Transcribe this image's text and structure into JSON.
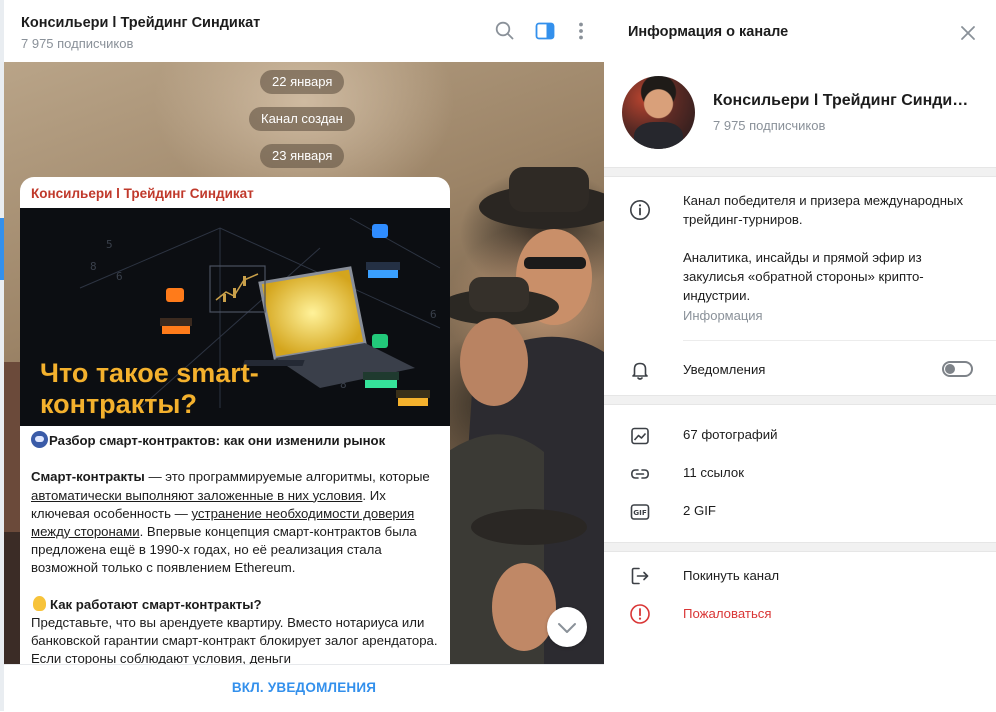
{
  "chat": {
    "title": "Консильери l Трейдинг Синдикат",
    "subscribers": "7 975 подписчиков",
    "date_pill_1": "22 января",
    "service_message": "Канал создан",
    "date_pill_2": "23 января",
    "message": {
      "author": "Консильери l Трейдинг Синдикат",
      "image_title": "Что такое smart-контракты?",
      "heading": "Разбор смарт-контрактов: как они изменили рынок",
      "p1_bold": "Смарт-контракты",
      "p1_a": " — это программируемые алгоритмы, которые ",
      "p1_link1": "автоматически выполняют заложенные в них условия",
      "p1_b": ". Их ключевая особенность — ",
      "p1_link2": "устранение необходимости доверия между сторонами",
      "p1_c": ". Впервые концепция смарт-контрактов была предложена ещё в 1990-х годах, но её реализация стала возможной только с появлением Ethereum.",
      "subheading": "Как работают смарт-контракты?",
      "p2": "Представьте, что вы арендуете квартиру. Вместо нотариуса или банковской гарантии смарт-контракт блокирует залог арендатора. Если стороны соблюдают условия, деньги"
    },
    "footer_button": "ВКЛ. УВЕДОМЛЕНИЯ"
  },
  "info_panel": {
    "header_title": "Информация о канале",
    "name": "Консильери l Трейдинг Синдикат",
    "subscribers": "7 975 подписчиков",
    "about_line1": "Канал победителя и призера международных трейдинг-турниров.",
    "about_line2": "Аналитика, инсайды и прямой эфир из закулисья «обратной стороны» крипто-индустрии.",
    "about_label": "Информация",
    "notifications_label": "Уведомления",
    "notifications_enabled": false,
    "media": {
      "photos": "67 фотографий",
      "links": "11 ссылок",
      "gifs": "2 GIF"
    },
    "actions": {
      "leave": "Покинуть канал",
      "report": "Пожаловаться"
    }
  },
  "colors": {
    "accent": "#3390ec",
    "author": "#c0392b",
    "danger": "#d93636",
    "muted": "#8a9199"
  },
  "icons": [
    "search-icon",
    "sidebar-toggle-icon",
    "more-vertical-icon",
    "chevron-down-icon",
    "close-icon",
    "info-icon",
    "bell-icon",
    "photo-icon",
    "link-icon",
    "gif-icon",
    "leave-icon",
    "report-icon"
  ]
}
